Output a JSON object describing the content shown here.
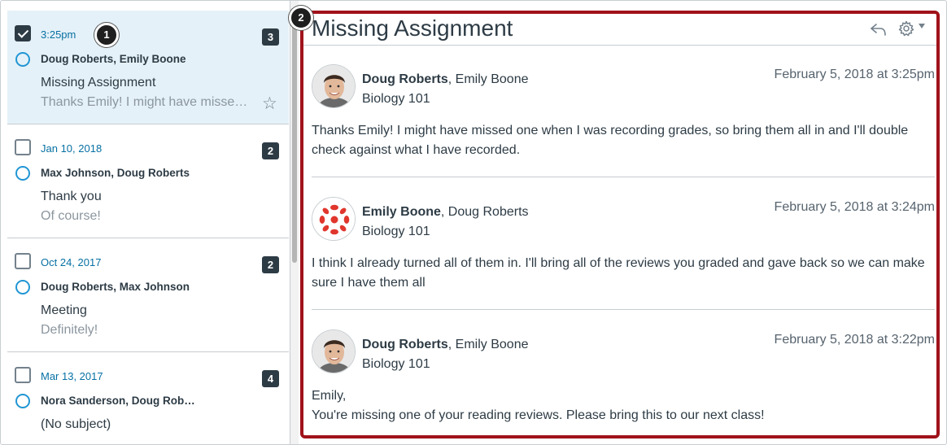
{
  "conversations": [
    {
      "date": "3:25pm",
      "count": "3",
      "participants": "Doug Roberts, Emily Boone",
      "subject": "Missing Assignment",
      "preview": "Thanks Emily! I might have missed one when I was recording grades",
      "selected": true,
      "starred_icon": "star-outline-icon"
    },
    {
      "date": "Jan 10, 2018",
      "count": "2",
      "participants": "Max Johnson, Doug Roberts",
      "subject": "Thank you",
      "preview": "Of course!",
      "selected": false
    },
    {
      "date": "Oct 24, 2017",
      "count": "2",
      "participants": "Doug Roberts, Max Johnson",
      "subject": "Meeting",
      "preview": "Definitely!",
      "selected": false
    },
    {
      "date": "Mar 13, 2017",
      "count": "4",
      "participants": "Nora Sanderson, Doug Rob…",
      "subject": "(No subject)",
      "preview": "",
      "selected": false
    }
  ],
  "callouts": {
    "list": "1",
    "detail": "2"
  },
  "detail": {
    "title": "Missing Assignment",
    "messages": [
      {
        "author": "Doug Roberts",
        "others": ", Emily Boone",
        "course": "Biology 101",
        "time": "February 5, 2018 at 3:25pm",
        "body": "Thanks Emily! I might have missed one when I was recording grades, so bring them all in and I'll double check against what I have recorded.",
        "avatar": "person-photo-avatar"
      },
      {
        "author": "Emily Boone",
        "others": ", Doug Roberts",
        "course": "Biology 101",
        "time": "February 5, 2018 at 3:24pm",
        "body": "I think I already turned all of them in. I'll bring all of the reviews you graded and gave back so we can make sure I have them all",
        "avatar": "canvas-logo-avatar"
      },
      {
        "author": "Doug Roberts",
        "others": ", Emily Boone",
        "course": "Biology 101",
        "time": "February 5, 2018 at 3:22pm",
        "body_line1": "Emily,",
        "body_line2": "You're missing one of your reading reviews. Please bring this to our next class!",
        "avatar": "person-photo-avatar"
      }
    ]
  },
  "colors": {
    "accent": "#0770a3",
    "highlight_border": "#a0121a",
    "selected_bg": "#e5f1f8",
    "badge": "#2d3b45"
  }
}
